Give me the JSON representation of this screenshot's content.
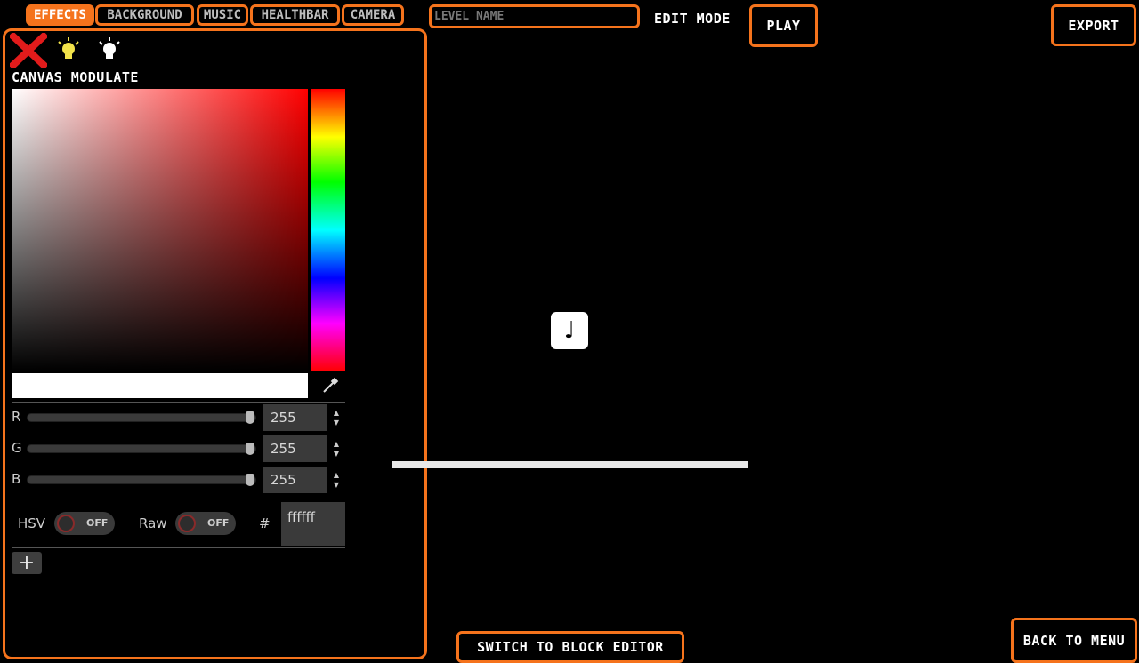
{
  "tabs": [
    {
      "label": "EFFECTS",
      "active": true
    },
    {
      "label": "BACKGROUND",
      "active": false
    },
    {
      "label": "MUSIC",
      "active": false
    },
    {
      "label": "HEALTHBAR",
      "active": false
    },
    {
      "label": "CAMERA",
      "active": false
    }
  ],
  "level_name": {
    "placeholder": "LEVEL NAME",
    "value": ""
  },
  "mode_label": "EDIT MODE",
  "play_label": "PLAY",
  "export_label": "EXPORT",
  "back_label": "BACK TO MENU",
  "switch_label": "SWITCH TO BLOCK EDITOR",
  "panel": {
    "section_title": "CANVAS MODULATE",
    "icons": [
      "close-icon",
      "lightbulb-on-icon",
      "lightbulb-off-icon"
    ],
    "picker": {
      "channels": [
        {
          "label": "R",
          "value": "255",
          "level": 1.0
        },
        {
          "label": "G",
          "value": "255",
          "level": 1.0
        },
        {
          "label": "B",
          "value": "255",
          "level": 1.0
        }
      ],
      "hsv_label": "HSV",
      "hsv_state": "OFF",
      "raw_label": "Raw",
      "raw_state": "OFF",
      "hash": "#",
      "hex_value": "ffffff"
    },
    "add_label": "+"
  },
  "colors": {
    "accent": "#f5731c",
    "background": "#000000",
    "close": "#e21b1b",
    "bulb_on": "#f2e24a"
  },
  "canvas": {
    "note_glyph": "♩"
  }
}
